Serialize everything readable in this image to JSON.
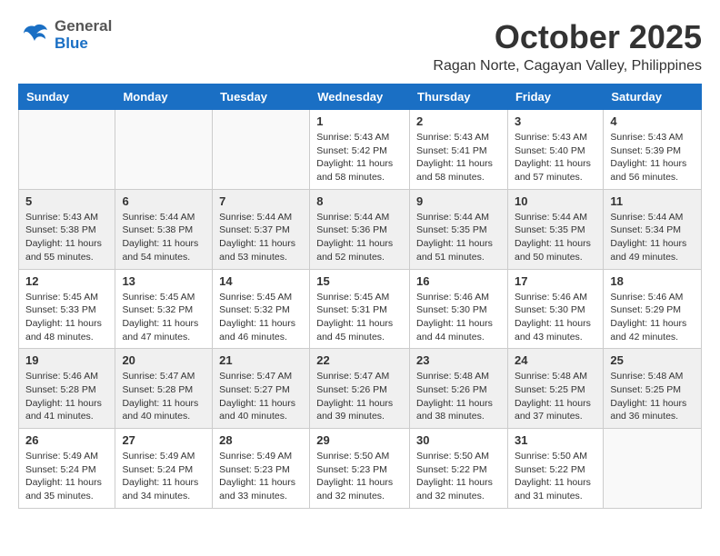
{
  "header": {
    "logo_general": "General",
    "logo_blue": "Blue",
    "month_title": "October 2025",
    "location": "Ragan Norte, Cagayan Valley, Philippines"
  },
  "weekdays": [
    "Sunday",
    "Monday",
    "Tuesday",
    "Wednesday",
    "Thursday",
    "Friday",
    "Saturday"
  ],
  "weeks": [
    [
      {
        "day": "",
        "sunrise": "",
        "sunset": "",
        "daylight": ""
      },
      {
        "day": "",
        "sunrise": "",
        "sunset": "",
        "daylight": ""
      },
      {
        "day": "",
        "sunrise": "",
        "sunset": "",
        "daylight": ""
      },
      {
        "day": "1",
        "sunrise": "Sunrise: 5:43 AM",
        "sunset": "Sunset: 5:42 PM",
        "daylight": "Daylight: 11 hours and 58 minutes."
      },
      {
        "day": "2",
        "sunrise": "Sunrise: 5:43 AM",
        "sunset": "Sunset: 5:41 PM",
        "daylight": "Daylight: 11 hours and 58 minutes."
      },
      {
        "day": "3",
        "sunrise": "Sunrise: 5:43 AM",
        "sunset": "Sunset: 5:40 PM",
        "daylight": "Daylight: 11 hours and 57 minutes."
      },
      {
        "day": "4",
        "sunrise": "Sunrise: 5:43 AM",
        "sunset": "Sunset: 5:39 PM",
        "daylight": "Daylight: 11 hours and 56 minutes."
      }
    ],
    [
      {
        "day": "5",
        "sunrise": "Sunrise: 5:43 AM",
        "sunset": "Sunset: 5:38 PM",
        "daylight": "Daylight: 11 hours and 55 minutes."
      },
      {
        "day": "6",
        "sunrise": "Sunrise: 5:44 AM",
        "sunset": "Sunset: 5:38 PM",
        "daylight": "Daylight: 11 hours and 54 minutes."
      },
      {
        "day": "7",
        "sunrise": "Sunrise: 5:44 AM",
        "sunset": "Sunset: 5:37 PM",
        "daylight": "Daylight: 11 hours and 53 minutes."
      },
      {
        "day": "8",
        "sunrise": "Sunrise: 5:44 AM",
        "sunset": "Sunset: 5:36 PM",
        "daylight": "Daylight: 11 hours and 52 minutes."
      },
      {
        "day": "9",
        "sunrise": "Sunrise: 5:44 AM",
        "sunset": "Sunset: 5:35 PM",
        "daylight": "Daylight: 11 hours and 51 minutes."
      },
      {
        "day": "10",
        "sunrise": "Sunrise: 5:44 AM",
        "sunset": "Sunset: 5:35 PM",
        "daylight": "Daylight: 11 hours and 50 minutes."
      },
      {
        "day": "11",
        "sunrise": "Sunrise: 5:44 AM",
        "sunset": "Sunset: 5:34 PM",
        "daylight": "Daylight: 11 hours and 49 minutes."
      }
    ],
    [
      {
        "day": "12",
        "sunrise": "Sunrise: 5:45 AM",
        "sunset": "Sunset: 5:33 PM",
        "daylight": "Daylight: 11 hours and 48 minutes."
      },
      {
        "day": "13",
        "sunrise": "Sunrise: 5:45 AM",
        "sunset": "Sunset: 5:32 PM",
        "daylight": "Daylight: 11 hours and 47 minutes."
      },
      {
        "day": "14",
        "sunrise": "Sunrise: 5:45 AM",
        "sunset": "Sunset: 5:32 PM",
        "daylight": "Daylight: 11 hours and 46 minutes."
      },
      {
        "day": "15",
        "sunrise": "Sunrise: 5:45 AM",
        "sunset": "Sunset: 5:31 PM",
        "daylight": "Daylight: 11 hours and 45 minutes."
      },
      {
        "day": "16",
        "sunrise": "Sunrise: 5:46 AM",
        "sunset": "Sunset: 5:30 PM",
        "daylight": "Daylight: 11 hours and 44 minutes."
      },
      {
        "day": "17",
        "sunrise": "Sunrise: 5:46 AM",
        "sunset": "Sunset: 5:30 PM",
        "daylight": "Daylight: 11 hours and 43 minutes."
      },
      {
        "day": "18",
        "sunrise": "Sunrise: 5:46 AM",
        "sunset": "Sunset: 5:29 PM",
        "daylight": "Daylight: 11 hours and 42 minutes."
      }
    ],
    [
      {
        "day": "19",
        "sunrise": "Sunrise: 5:46 AM",
        "sunset": "Sunset: 5:28 PM",
        "daylight": "Daylight: 11 hours and 41 minutes."
      },
      {
        "day": "20",
        "sunrise": "Sunrise: 5:47 AM",
        "sunset": "Sunset: 5:28 PM",
        "daylight": "Daylight: 11 hours and 40 minutes."
      },
      {
        "day": "21",
        "sunrise": "Sunrise: 5:47 AM",
        "sunset": "Sunset: 5:27 PM",
        "daylight": "Daylight: 11 hours and 40 minutes."
      },
      {
        "day": "22",
        "sunrise": "Sunrise: 5:47 AM",
        "sunset": "Sunset: 5:26 PM",
        "daylight": "Daylight: 11 hours and 39 minutes."
      },
      {
        "day": "23",
        "sunrise": "Sunrise: 5:48 AM",
        "sunset": "Sunset: 5:26 PM",
        "daylight": "Daylight: 11 hours and 38 minutes."
      },
      {
        "day": "24",
        "sunrise": "Sunrise: 5:48 AM",
        "sunset": "Sunset: 5:25 PM",
        "daylight": "Daylight: 11 hours and 37 minutes."
      },
      {
        "day": "25",
        "sunrise": "Sunrise: 5:48 AM",
        "sunset": "Sunset: 5:25 PM",
        "daylight": "Daylight: 11 hours and 36 minutes."
      }
    ],
    [
      {
        "day": "26",
        "sunrise": "Sunrise: 5:49 AM",
        "sunset": "Sunset: 5:24 PM",
        "daylight": "Daylight: 11 hours and 35 minutes."
      },
      {
        "day": "27",
        "sunrise": "Sunrise: 5:49 AM",
        "sunset": "Sunset: 5:24 PM",
        "daylight": "Daylight: 11 hours and 34 minutes."
      },
      {
        "day": "28",
        "sunrise": "Sunrise: 5:49 AM",
        "sunset": "Sunset: 5:23 PM",
        "daylight": "Daylight: 11 hours and 33 minutes."
      },
      {
        "day": "29",
        "sunrise": "Sunrise: 5:50 AM",
        "sunset": "Sunset: 5:23 PM",
        "daylight": "Daylight: 11 hours and 32 minutes."
      },
      {
        "day": "30",
        "sunrise": "Sunrise: 5:50 AM",
        "sunset": "Sunset: 5:22 PM",
        "daylight": "Daylight: 11 hours and 32 minutes."
      },
      {
        "day": "31",
        "sunrise": "Sunrise: 5:50 AM",
        "sunset": "Sunset: 5:22 PM",
        "daylight": "Daylight: 11 hours and 31 minutes."
      },
      {
        "day": "",
        "sunrise": "",
        "sunset": "",
        "daylight": ""
      }
    ]
  ]
}
